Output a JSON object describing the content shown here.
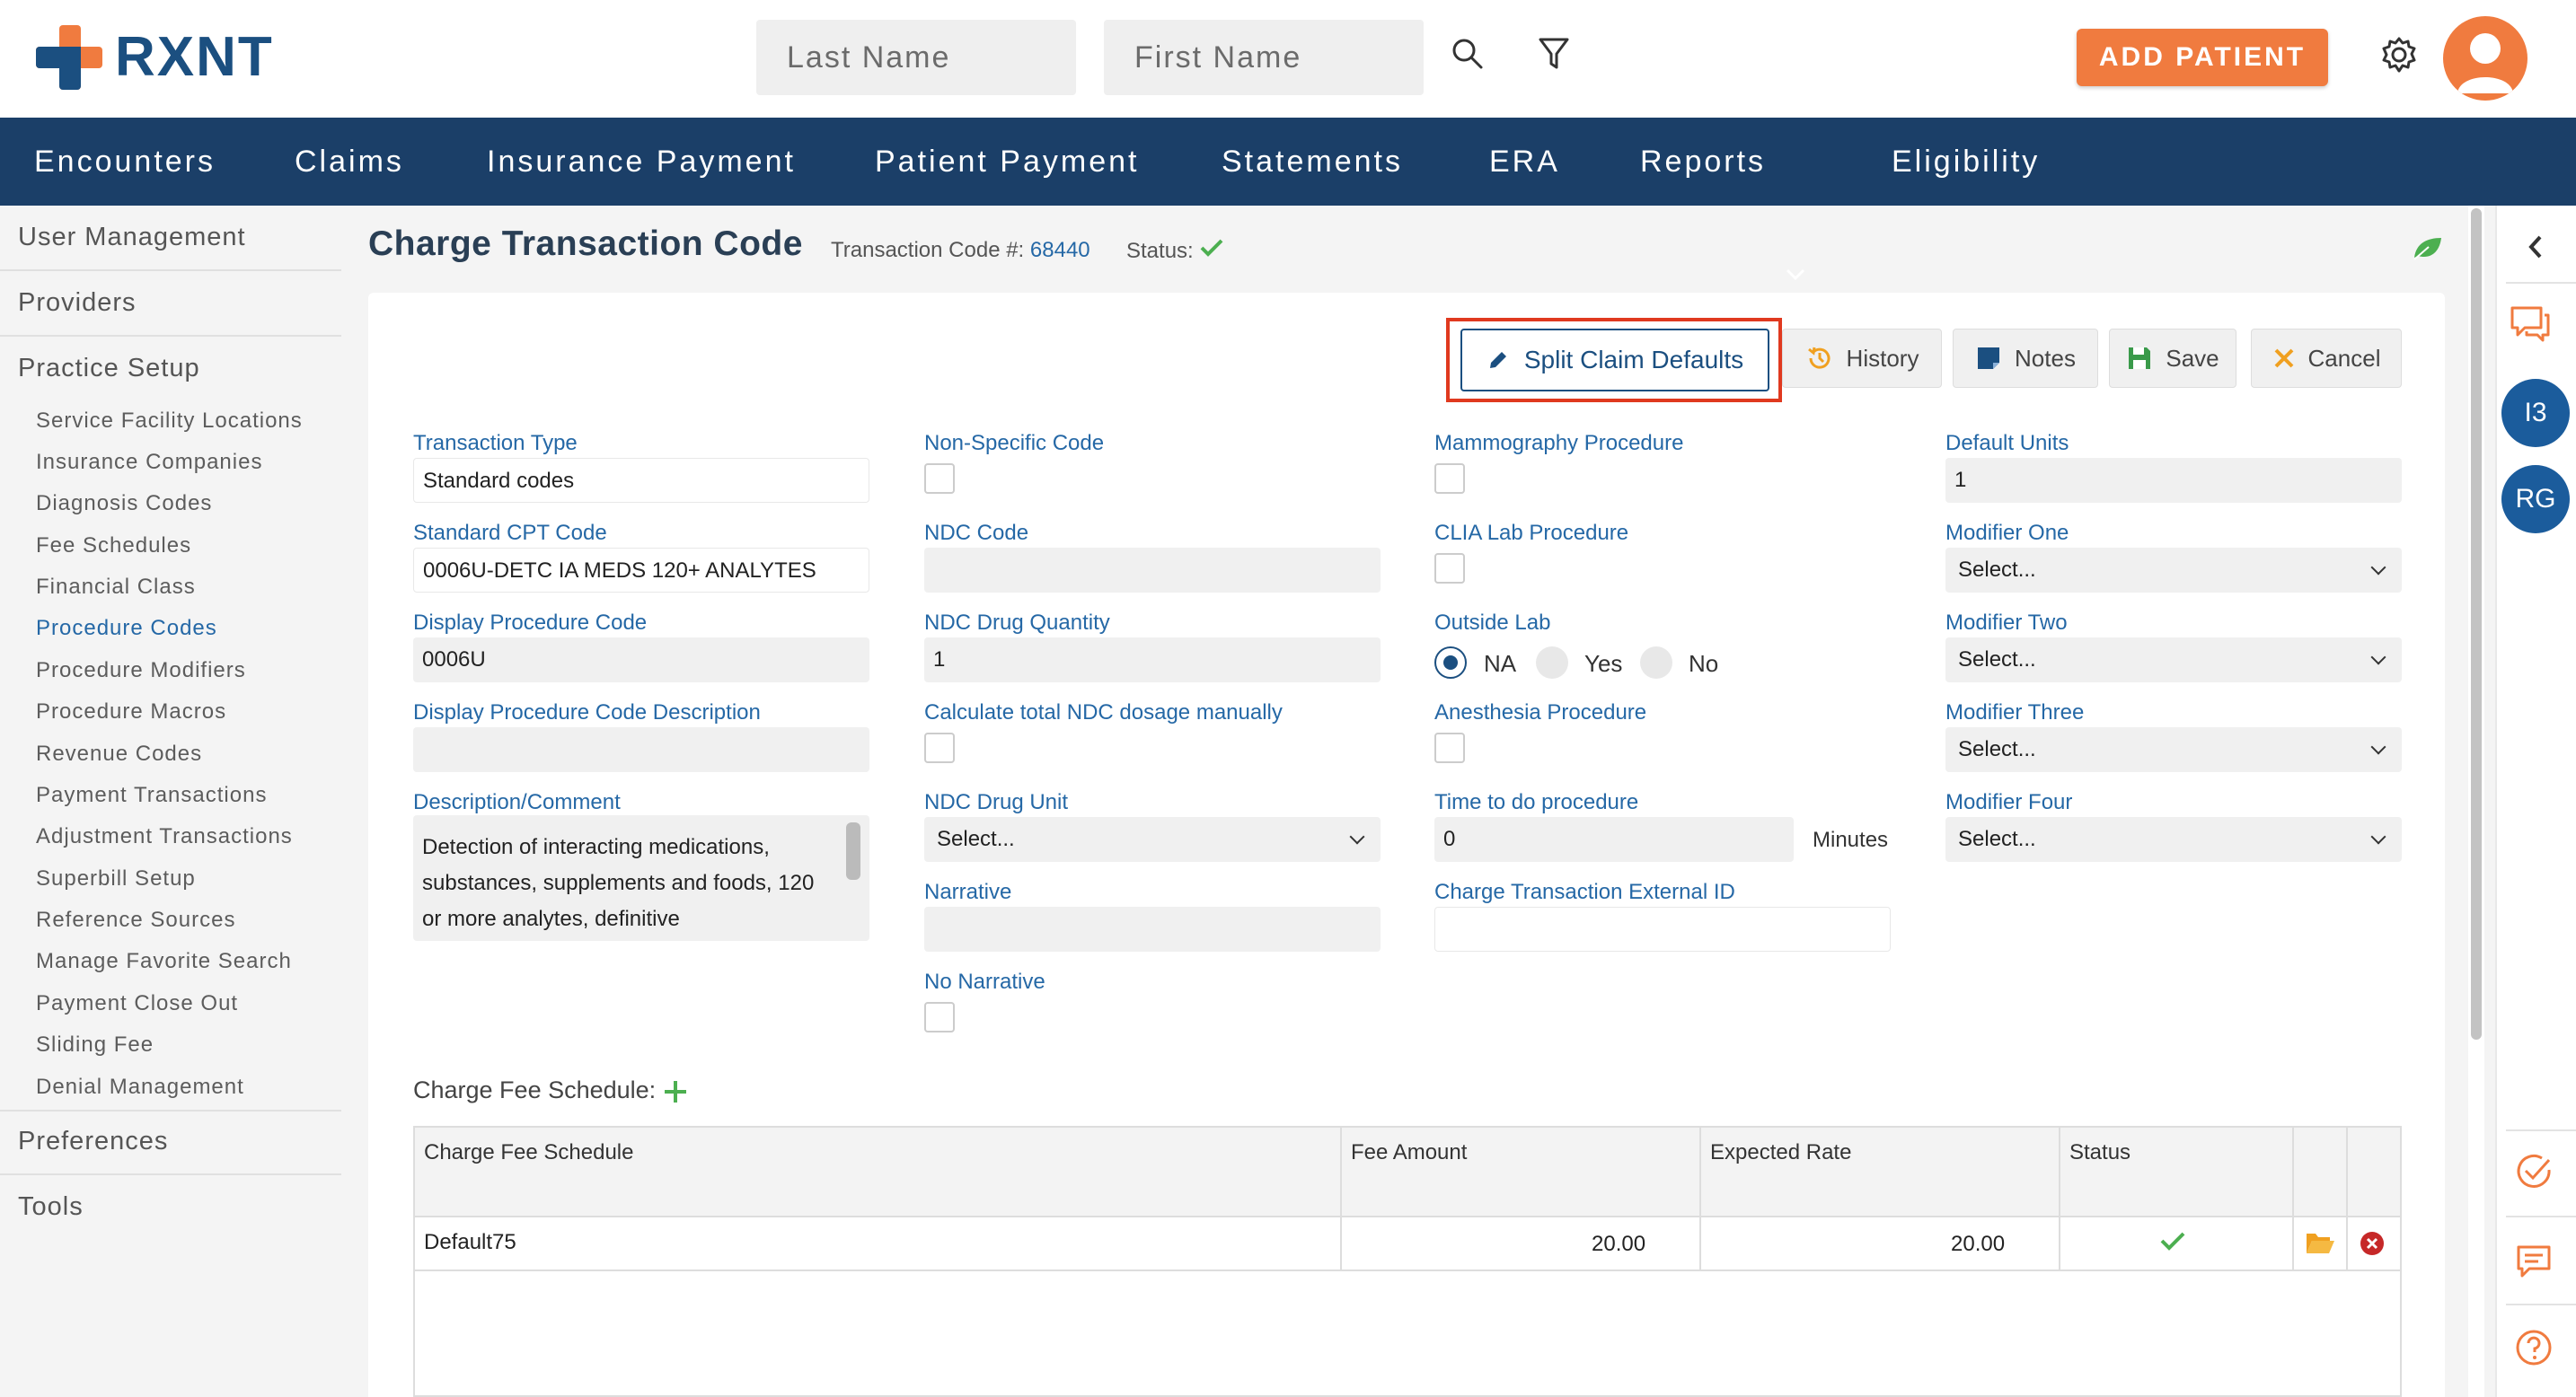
{
  "brand": {
    "name": "RXNT"
  },
  "header": {
    "last_name_placeholder": "Last Name",
    "first_name_placeholder": "First Name",
    "add_patient_label": "ADD PATIENT"
  },
  "nav": [
    "Encounters",
    "Claims",
    "Insurance Payment",
    "Patient Payment",
    "Statements",
    "ERA",
    "Reports",
    "Eligibility"
  ],
  "sidebar": {
    "sections": [
      "User Management",
      "Providers",
      "Practice Setup",
      "Preferences",
      "Tools"
    ],
    "practice_setup_items": [
      "Service Facility Locations",
      "Insurance Companies",
      "Diagnosis Codes",
      "Fee Schedules",
      "Financial Class",
      "Procedure Codes",
      "Procedure Modifiers",
      "Procedure Macros",
      "Revenue Codes",
      "Payment Transactions",
      "Adjustment Transactions",
      "Superbill Setup",
      "Reference Sources",
      "Manage Favorite Search",
      "Payment Close Out",
      "Sliding Fee",
      "Denial Management"
    ],
    "active_item": "Procedure Codes"
  },
  "page": {
    "title": "Charge Transaction Code",
    "transaction_code_label": "Transaction Code #:",
    "transaction_code": "68440",
    "status_label": "Status:"
  },
  "toolbar": {
    "split_claim_defaults": "Split Claim Defaults",
    "history": "History",
    "notes": "Notes",
    "save": "Save",
    "cancel": "Cancel"
  },
  "form": {
    "transaction_type": {
      "label": "Transaction Type",
      "value": "Standard codes"
    },
    "standard_cpt_code": {
      "label": "Standard CPT Code",
      "value": "0006U-DETC IA MEDS 120+ ANALYTES"
    },
    "display_procedure_code": {
      "label": "Display Procedure Code",
      "value": "0006U"
    },
    "display_procedure_code_description": {
      "label": "Display Procedure Code Description",
      "value": ""
    },
    "description_comment": {
      "label": "Description/Comment",
      "value": "Detection of interacting medications, substances, supplements and foods, 120 or more analytes, definitive"
    },
    "non_specific_code": {
      "label": "Non-Specific Code"
    },
    "ndc_code": {
      "label": "NDC Code",
      "value": ""
    },
    "ndc_drug_quantity": {
      "label": "NDC Drug Quantity",
      "value": "1"
    },
    "calc_ndc": {
      "label": "Calculate total NDC dosage manually"
    },
    "ndc_drug_unit": {
      "label": "NDC Drug Unit",
      "value": "Select..."
    },
    "narrative": {
      "label": "Narrative",
      "value": ""
    },
    "no_narrative": {
      "label": "No Narrative"
    },
    "mammography_procedure": {
      "label": "Mammography Procedure"
    },
    "clia_lab_procedure": {
      "label": "CLIA Lab Procedure"
    },
    "outside_lab": {
      "label": "Outside Lab",
      "options": [
        "NA",
        "Yes",
        "No"
      ],
      "selected": "NA"
    },
    "anesthesia_procedure": {
      "label": "Anesthesia Procedure"
    },
    "time_to_do_procedure": {
      "label": "Time to do procedure",
      "value": "0",
      "unit": "Minutes"
    },
    "charge_transaction_external_id": {
      "label": "Charge Transaction External ID",
      "value": ""
    },
    "default_units": {
      "label": "Default Units",
      "value": "1"
    },
    "modifier_one": {
      "label": "Modifier One",
      "value": "Select..."
    },
    "modifier_two": {
      "label": "Modifier Two",
      "value": "Select..."
    },
    "modifier_three": {
      "label": "Modifier Three",
      "value": "Select..."
    },
    "modifier_four": {
      "label": "Modifier Four",
      "value": "Select..."
    }
  },
  "fee_schedule": {
    "label": "Charge Fee Schedule:",
    "columns": [
      "Charge Fee Schedule",
      "Fee Amount",
      "Expected Rate",
      "Status"
    ],
    "rows": [
      {
        "name": "Default75",
        "fee_amount": "20.00",
        "expected_rate": "20.00"
      }
    ]
  },
  "right_rail": {
    "badges": [
      "I3",
      "RG"
    ]
  },
  "colors": {
    "brand_blue": "#1b4f80",
    "nav_bg": "#1b3f68",
    "accent_orange": "#f07b3f",
    "link_blue": "#2568a6",
    "success_green": "#4caf50",
    "highlight_red": "#e0391f"
  }
}
